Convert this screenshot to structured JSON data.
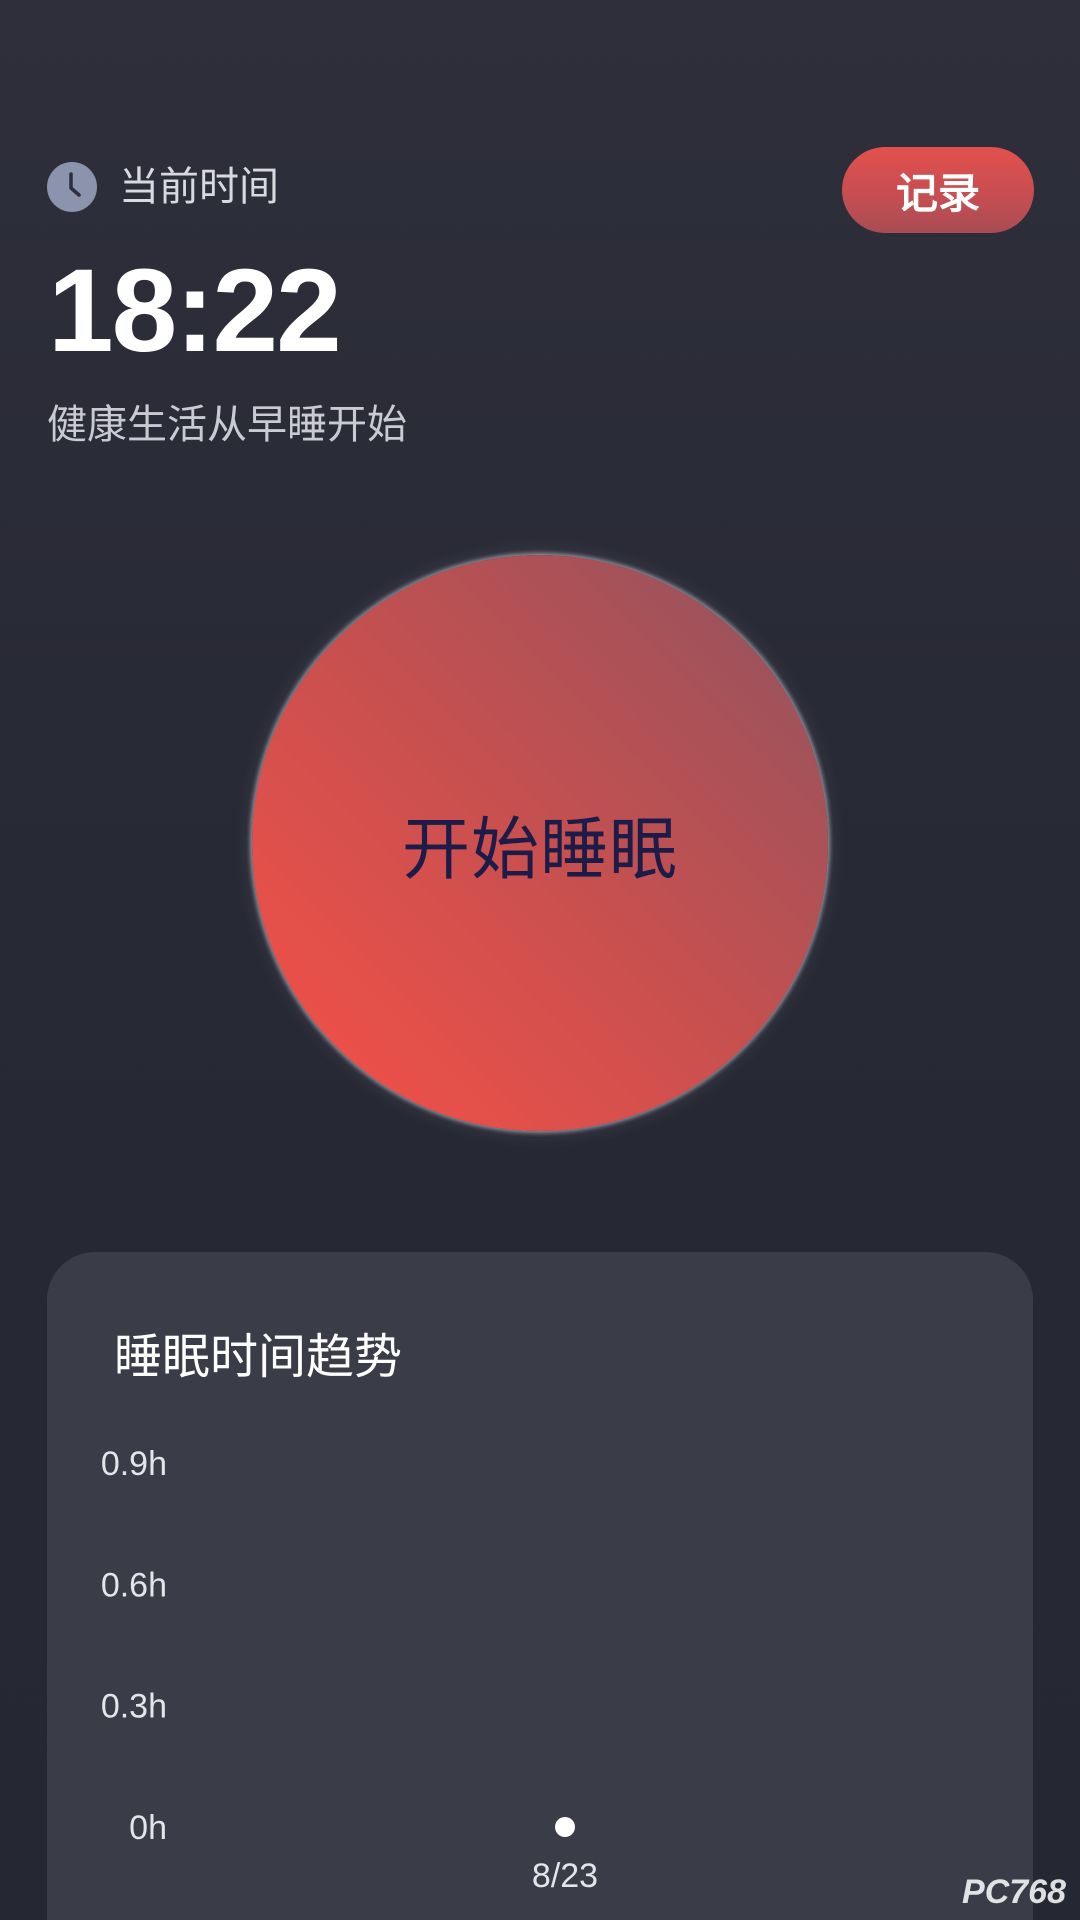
{
  "header": {
    "current_time_label": "当前时间",
    "record_button_label": "记录",
    "clock_icon": "clock-icon"
  },
  "clock": {
    "time": "18:22"
  },
  "slogan": "健康生活从早睡开始",
  "sleep_button": {
    "label": "开始睡眠"
  },
  "trend_card": {
    "title": "睡眠时间趋势"
  },
  "chart_data": {
    "type": "scatter",
    "title": "睡眠时间趋势",
    "xlabel": "",
    "ylabel": "",
    "y_ticks": [
      "0h",
      "0.3h",
      "0.6h",
      "0.9h"
    ],
    "y_tick_values": [
      0,
      0.3,
      0.6,
      0.9
    ],
    "ylim": [
      0,
      0.9
    ],
    "categories": [
      "8/23"
    ],
    "values": [
      0
    ],
    "point_color": "#ffffff",
    "grid": false,
    "legend": "none"
  },
  "colors": {
    "background": "#272935",
    "accent": "#f5514a",
    "card": "#3a3c48",
    "sleep_label": "#1d1c48"
  },
  "watermark": "PC768"
}
